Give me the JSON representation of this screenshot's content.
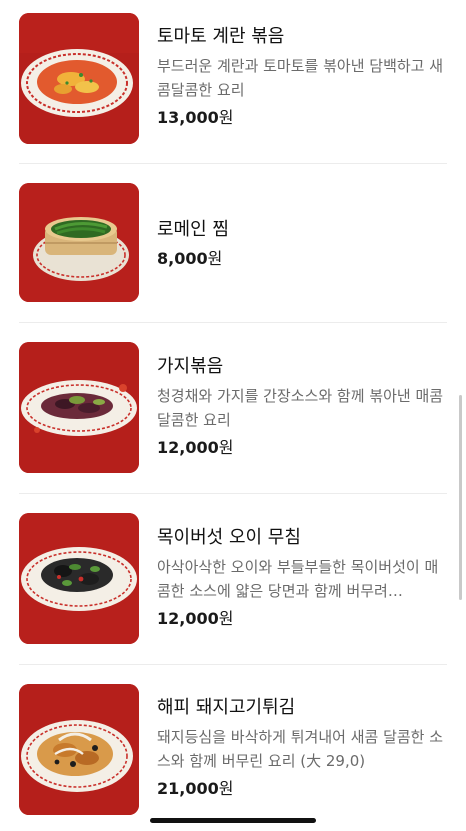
{
  "menu": {
    "items": [
      {
        "name": "토마토 계란 볶음",
        "description": "부드러운 계란과 토마토를 볶아낸 담백하고 새콤달콤한 요리",
        "price": "13,000",
        "currency": "원",
        "image_icon": "tomato-egg-dish-photo"
      },
      {
        "name": "로메인 찜",
        "description": "",
        "price": "8,000",
        "currency": "원",
        "image_icon": "steamed-romaine-photo"
      },
      {
        "name": "가지볶음",
        "description": "청경채와 가지를 간장소스와 함께 볶아낸 매콤달콤한 요리",
        "price": "12,000",
        "currency": "원",
        "image_icon": "eggplant-stirfry-photo"
      },
      {
        "name": "목이버섯 오이 무침",
        "description": "아삭아삭한 오이와 부들부들한 목이버섯이 매콤한 소스에 얇은 당면과 함께 버무려…",
        "price": "12,000",
        "currency": "원",
        "image_icon": "wood-ear-cucumber-salad-photo"
      },
      {
        "name": "해피 돼지고기튀김",
        "description": "돼지등심을 바삭하게 튀겨내어 새콤 달콤한 소스와 함께 버무린 요리 (大 29,0)",
        "price": "21,000",
        "currency": "원",
        "image_icon": "sweet-sour-pork-photo"
      }
    ]
  },
  "colors": {
    "thumb_background": "#b8201c",
    "description_text": "#6b6b6b",
    "divider": "#ececec"
  }
}
